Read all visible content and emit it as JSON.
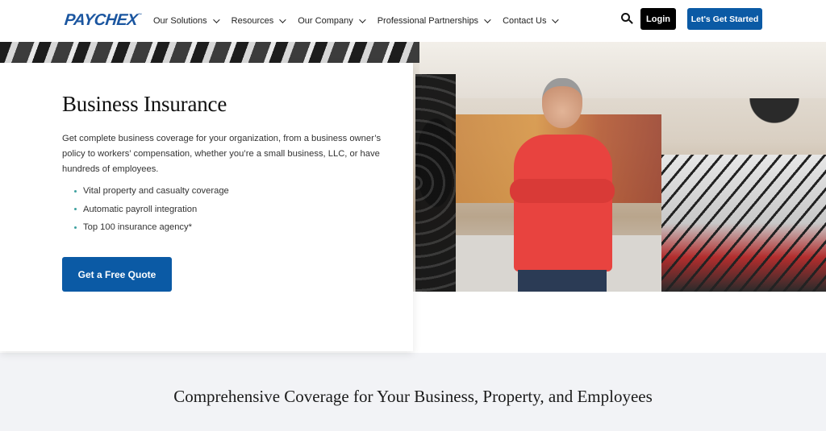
{
  "header": {
    "logo": "PAYCHEX",
    "nav": [
      {
        "label": "Our Solutions"
      },
      {
        "label": "Resources"
      },
      {
        "label": "Our Company"
      },
      {
        "label": "Professional Partnerships"
      },
      {
        "label": "Contact Us"
      }
    ],
    "search_icon": "search-icon",
    "login_label": "Login",
    "cta_label": "Let's Get Started"
  },
  "hero": {
    "title": "Business Insurance",
    "description": "Get complete business coverage for your organization, from a business owner’s policy to workers’ compensation, whether you’re a small business, LLC, or have hundreds of employees.",
    "bullets": [
      "Vital property and casualty coverage",
      "Automatic payroll integration",
      "Top 100 insurance agency*"
    ],
    "button_label": "Get a Free Quote",
    "image_alt": "Smiling bike shop owner in red sweater with arms crossed"
  },
  "section2": {
    "title": "Comprehensive Coverage for Your Business, Property, and Employees"
  },
  "colors": {
    "brand_blue": "#0b5aa5",
    "logo_blue": "#1b56a0",
    "bullet_teal": "#3fa1a0",
    "section_bg": "#f2f3f6"
  }
}
